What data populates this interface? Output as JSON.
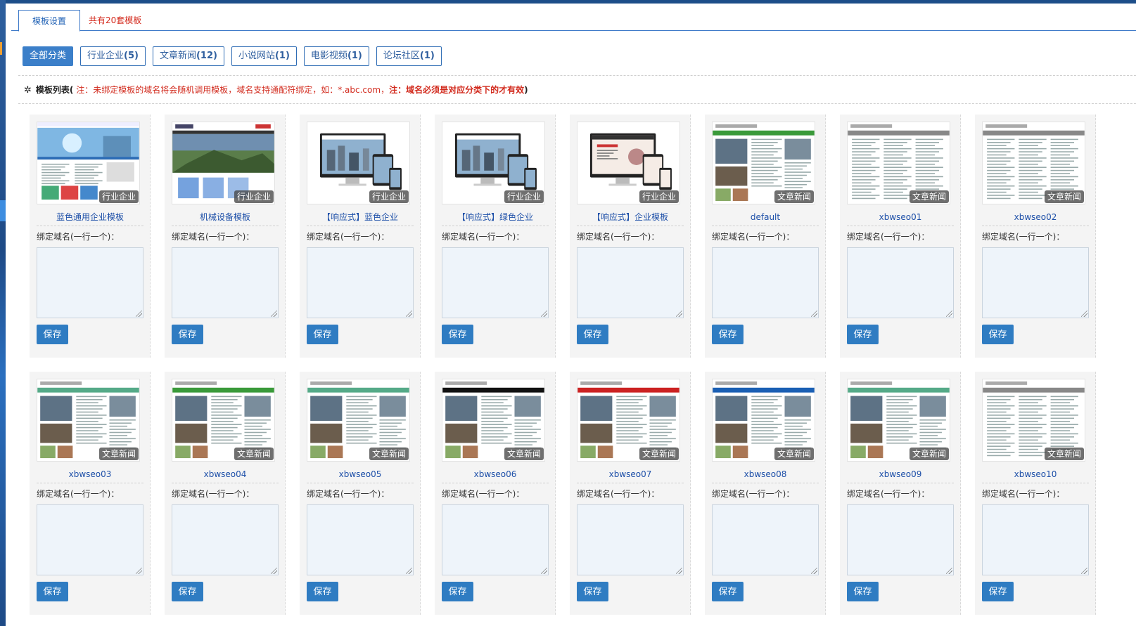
{
  "tabs": {
    "active": "模板设置",
    "count": "共有20套模板"
  },
  "filters": [
    {
      "label": "全部分类",
      "count": "",
      "active": true
    },
    {
      "label": "行业企业",
      "count": "(5)",
      "active": false
    },
    {
      "label": "文章新闻",
      "count": "(12)",
      "active": false
    },
    {
      "label": "小说网站",
      "count": "(1)",
      "active": false
    },
    {
      "label": "电影视频",
      "count": "(1)",
      "active": false
    },
    {
      "label": "论坛社区",
      "count": "(1)",
      "active": false
    }
  ],
  "notice": {
    "gear_icon": "gear-icon",
    "label": "模板列表",
    "open": "(",
    "text": "注：未绑定模板的域名将会随机调用模板，域名支持通配符绑定，如：*.abc.com，",
    "strong": "注：域名必须是对应分类下的才有效",
    "close": ")"
  },
  "card_common": {
    "domain_label": "绑定域名(一行一个)：",
    "save_label": "保存"
  },
  "templates": [
    {
      "name": "蓝色通用企业模板",
      "category": "行业企业",
      "style": "corp-blue"
    },
    {
      "name": "机械设备模板",
      "category": "行业企业",
      "style": "corp-machine"
    },
    {
      "name": "【响应式】蓝色企业",
      "category": "行业企业",
      "style": "devices"
    },
    {
      "name": "【响应式】绿色企业",
      "category": "行业企业",
      "style": "devices"
    },
    {
      "name": "【响应式】企业模板",
      "category": "行业企业",
      "style": "devices-red"
    },
    {
      "name": "default",
      "category": "文章新闻",
      "style": "news-green"
    },
    {
      "name": "xbwseo01",
      "category": "文章新闻",
      "style": "news-list"
    },
    {
      "name": "xbwseo02",
      "category": "文章新闻",
      "style": "news-list"
    },
    {
      "name": "xbwseo03",
      "category": "文章新闻",
      "style": "news-photo"
    },
    {
      "name": "xbwseo04",
      "category": "文章新闻",
      "style": "news-green"
    },
    {
      "name": "xbwseo05",
      "category": "文章新闻",
      "style": "news-photo"
    },
    {
      "name": "xbwseo06",
      "category": "文章新闻",
      "style": "news-dark"
    },
    {
      "name": "xbwseo07",
      "category": "文章新闻",
      "style": "news-red"
    },
    {
      "name": "xbwseo08",
      "category": "文章新闻",
      "style": "news-blue"
    },
    {
      "name": "xbwseo09",
      "category": "文章新闻",
      "style": "news-photo"
    },
    {
      "name": "xbwseo10",
      "category": "文章新闻",
      "style": "news-list"
    }
  ],
  "colors": {
    "accent": "#2f7cc2",
    "tab_border": "#3c78c8",
    "notice_red": "#d22b1e",
    "link": "#1d4fa8"
  }
}
